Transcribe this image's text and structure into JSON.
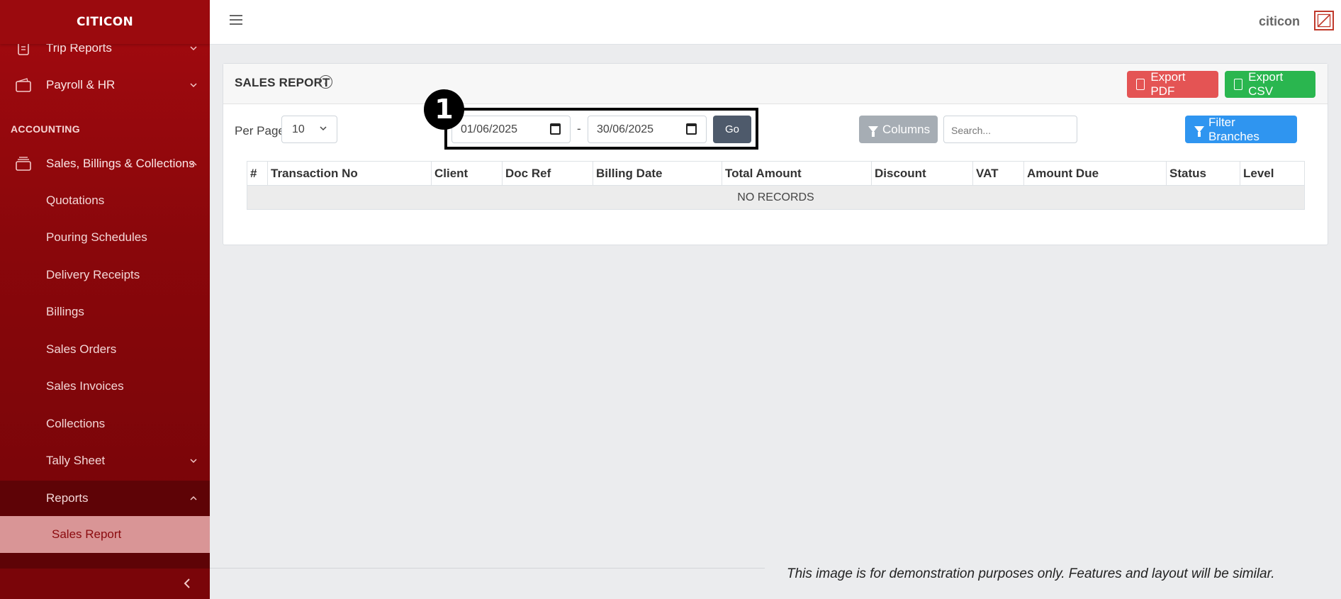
{
  "sidebar": {
    "brand": "CITICON",
    "top_items": [
      {
        "label": "Trip Reports"
      },
      {
        "label": "Payroll & HR"
      }
    ],
    "section_title": "ACCOUNTING",
    "group": {
      "label": "Sales, Billings & Collections"
    },
    "sub_items": [
      {
        "label": "Quotations"
      },
      {
        "label": "Pouring Schedules"
      },
      {
        "label": "Delivery Receipts"
      },
      {
        "label": "Billings"
      },
      {
        "label": "Sales Orders"
      },
      {
        "label": "Sales Invoices"
      },
      {
        "label": "Collections"
      },
      {
        "label": "Tally Sheet"
      },
      {
        "label": "Reports"
      }
    ],
    "active_item": "Sales Report"
  },
  "topbar": {
    "username": "citicon"
  },
  "card": {
    "title": "SALES REPORT",
    "export_pdf": "Export PDF",
    "export_csv": "Export CSV",
    "per_page_label": "Per Page",
    "per_page_value": "10",
    "date_from": "01/06/2025",
    "date_separator": "-",
    "date_to": "30/06/2025",
    "go_label": "Go",
    "columns_label": "Columns",
    "search_placeholder": "Search...",
    "filter_branches_label": "Filter Branches",
    "marker": "1"
  },
  "table": {
    "headers": [
      "#",
      "Transaction No",
      "Client",
      "Doc Ref",
      "Billing Date",
      "Total Amount",
      "Discount",
      "VAT",
      "Amount Due",
      "Status",
      "Level"
    ],
    "empty_text": "NO RECORDS"
  },
  "disclaimer": "This image is for demonstration purposes only. Features and layout will be similar.",
  "colors": {
    "sidebar": "#8a070b",
    "active_item_bg": "#d99596",
    "export_pdf": "#e45454",
    "export_csv": "#2ab64f",
    "filter_branches": "#2f95f0",
    "go": "#4e5a6b",
    "columns": "#a6adb4"
  },
  "icons": {
    "trip_reports": "document-icon",
    "payroll": "wallet-icon",
    "sales": "stack-icon",
    "info": "info-icon",
    "pdf": "file-pdf-icon",
    "csv": "file-csv-icon",
    "calendar": "calendar-icon",
    "filter": "funnel-icon"
  }
}
